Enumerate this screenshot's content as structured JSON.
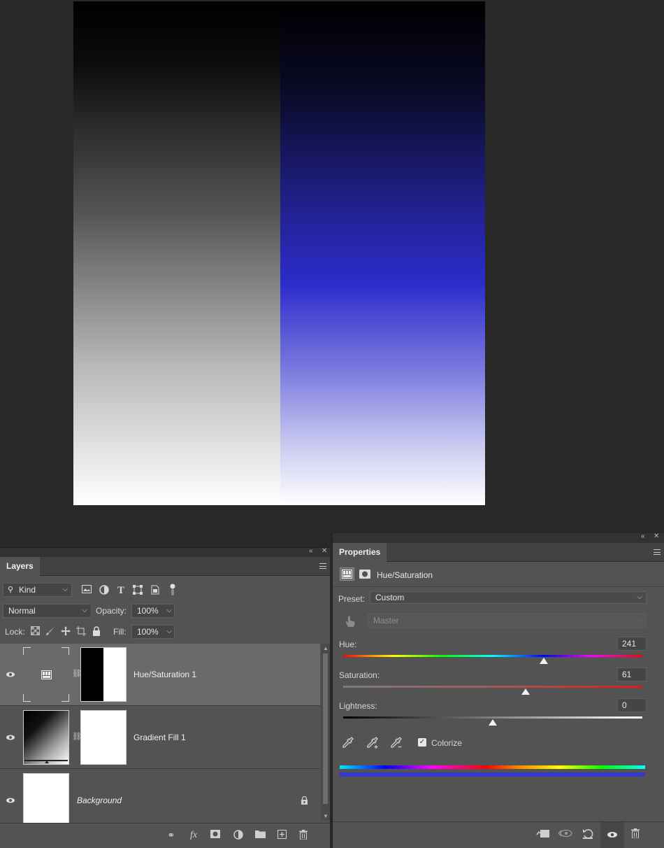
{
  "layers_panel": {
    "title": "Layers",
    "filter": {
      "kind_label": "Kind"
    },
    "blend_mode": "Normal",
    "opacity_label": "Opacity:",
    "opacity_value": "100%",
    "lock_label": "Lock:",
    "fill_label": "Fill:",
    "fill_value": "100%",
    "layers": [
      {
        "name": "Hue/Saturation 1",
        "selected": true
      },
      {
        "name": "Gradient Fill 1",
        "selected": false
      },
      {
        "name": "Background",
        "selected": false,
        "locked": true
      }
    ]
  },
  "properties_panel": {
    "title": "Properties",
    "adjustment_name": "Hue/Saturation",
    "preset_label": "Preset:",
    "preset_value": "Custom",
    "channel_value": "Master",
    "hue_label": "Hue:",
    "hue_value": "241",
    "saturation_label": "Saturation:",
    "saturation_value": "61",
    "lightness_label": "Lightness:",
    "lightness_value": "0",
    "colorize_label": "Colorize",
    "colorize_checked": true
  },
  "colors": {
    "panel_bg": "#535353",
    "workspace_bg": "#282828",
    "colorize_bar": "#3737c9"
  }
}
